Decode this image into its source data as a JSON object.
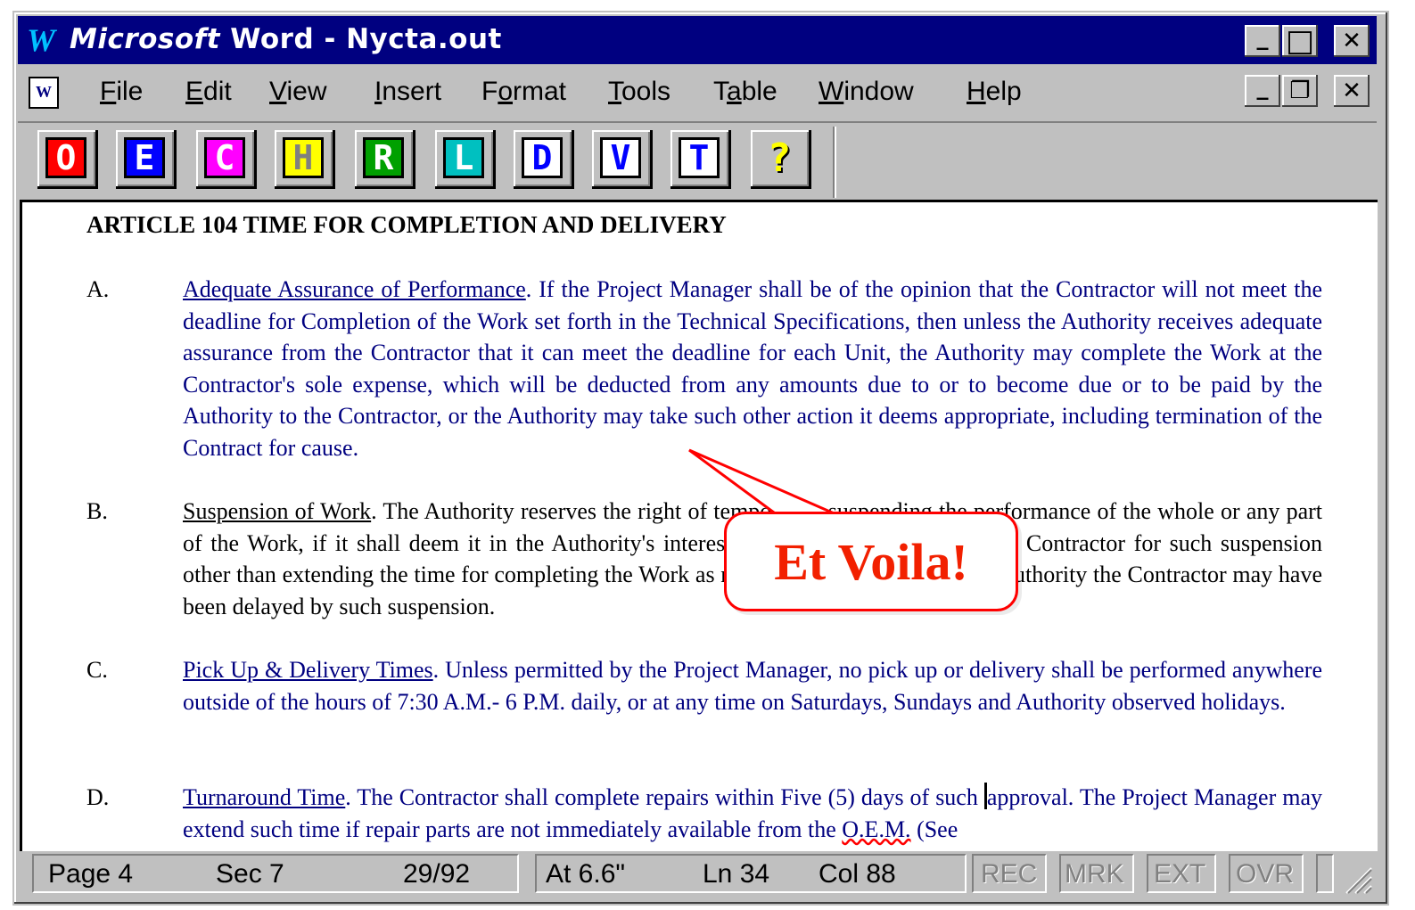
{
  "window": {
    "logo": "W",
    "title_brand": "Microsoft",
    "title_rest": " Word - Nycta.out",
    "controls": {
      "minimize": "_",
      "maximize": "□",
      "close": "✕"
    },
    "doc_controls": {
      "minimize": "_",
      "restore": "❐",
      "close": "✕"
    }
  },
  "menu": {
    "items": [
      {
        "pre": "",
        "key": "F",
        "post": "ile"
      },
      {
        "pre": "",
        "key": "E",
        "post": "dit"
      },
      {
        "pre": "",
        "key": "V",
        "post": "iew"
      },
      {
        "pre": "",
        "key": "I",
        "post": "nsert"
      },
      {
        "pre": "F",
        "key": "o",
        "post": "rmat"
      },
      {
        "pre": "",
        "key": "T",
        "post": "ools"
      },
      {
        "pre": "T",
        "key": "a",
        "post": "ble"
      },
      {
        "pre": "",
        "key": "W",
        "post": "indow"
      },
      {
        "pre": "",
        "key": "H",
        "post": "elp"
      }
    ]
  },
  "toolbar": {
    "buttons": [
      {
        "label": "O",
        "bg": "#ff0000",
        "fg": "#ffffff"
      },
      {
        "label": "E",
        "bg": "#0000ff",
        "fg": "#ffffff"
      },
      {
        "label": "C",
        "bg": "#ff00ff",
        "fg": "#ffffff"
      },
      {
        "label": "H",
        "bg": "#ffff00",
        "fg": "#808080"
      },
      {
        "label": "R",
        "bg": "#00a000",
        "fg": "#ffffff"
      },
      {
        "label": "L",
        "bg": "#00c0c0",
        "fg": "#ffffff"
      },
      {
        "label": "D",
        "bg": "#ffffff",
        "fg": "#0000ff"
      },
      {
        "label": "V",
        "bg": "#ffffff",
        "fg": "#0000ff"
      },
      {
        "label": "T",
        "bg": "#ffffff",
        "fg": "#0000ff"
      },
      {
        "label": "?",
        "bg": "#c0c0c0",
        "fg": "#ffff00",
        "icon": "help-question-icon"
      }
    ]
  },
  "document": {
    "article_heading": "ARTICLE 104   TIME FOR COMPLETION AND DELIVERY",
    "paragraphs": [
      {
        "letter": "A.",
        "heading": "Adequate Assurance of Performance",
        "text": ".  If the Project Manager shall be of the opinion that the Contractor will not meet the deadline for Completion of the Work set forth in the Technical Specifications, then unless the Authority receives adequate assurance from the Contractor that it can meet the deadline for each Unit, the Authority may complete the Work at the Contractor's sole expense, which will be deducted from any amounts due to or to become due or to be paid by the Authority to the Contractor, or the Authority may take such other action it deems appropriate, including termination of the Contract for cause.",
        "color": "blue"
      },
      {
        "letter": "B.",
        "heading": "Suspension of Work",
        "text": ".  The Authority reserves the right of temporarily suspending the performance of the whole or any part of the Work, if it shall deem it in the Authority's interest, without compensation to the Contractor for such suspension other than extending the time for completing the Work as much as in the opinion of the Authority the Contractor may have been delayed by such suspension.",
        "color": "black"
      },
      {
        "letter": "C.",
        "heading": "Pick Up & Delivery Times",
        "text": ".  Unless permitted by the Project Manager, no pick up or delivery shall be performed anywhere outside of the hours of 7:30 A.M.- 6 P.M. daily, or at any time on Saturdays, Sundays and Authority observed holidays.",
        "color": "blue"
      },
      {
        "letter": "D.",
        "heading": "Turnaround Time",
        "text_before_cursor": ". The Contractor shall complete repairs within Five (5) days of such ",
        "text_after_cursor": "approval.  The Project Manager may extend such time if repair parts are not immediately available from the ",
        "oem": "O.E.M.",
        "text_end": "  (See",
        "color": "blue"
      }
    ]
  },
  "callout": {
    "text": "Et Voila!"
  },
  "status": {
    "page": "Page  4",
    "sec": "Sec  7",
    "pages": "29/92",
    "at": "At  6.6\"",
    "ln": "Ln  34",
    "col": "Col  88",
    "rec": "REC",
    "mrk": "MRK",
    "ext": "EXT",
    "ovr": "OVR"
  }
}
